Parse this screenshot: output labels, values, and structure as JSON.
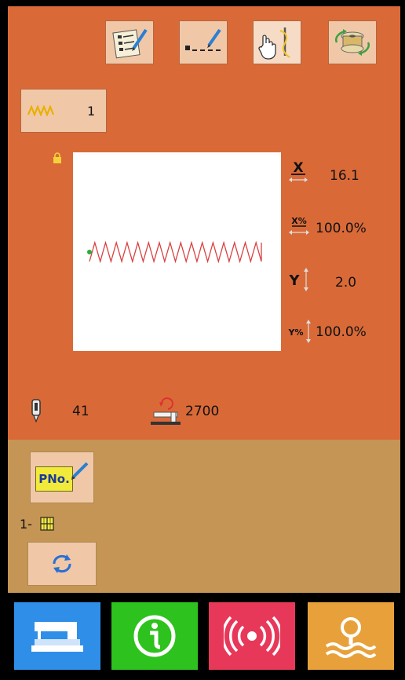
{
  "toolbar": {
    "items": [
      {
        "name": "checklist-edit-icon"
      },
      {
        "name": "dashed-line-edit-icon"
      },
      {
        "name": "hand-needle-icon"
      },
      {
        "name": "bobbin-wind-icon"
      }
    ]
  },
  "stitch": {
    "icon": "zigzag-icon",
    "value": "1"
  },
  "params": {
    "x": {
      "value": "16.1",
      "icon": "x-length-icon"
    },
    "x_scale": {
      "value": "100.0%",
      "icon": "x-scale-icon"
    },
    "y": {
      "value": "2.0",
      "icon": "y-length-icon"
    },
    "y_scale": {
      "value": "100.0%",
      "icon": "y-scale-icon"
    }
  },
  "status": {
    "needle": {
      "value": "41",
      "icon": "needle-icon"
    },
    "counter": {
      "value": "2700",
      "icon": "counter-icon"
    }
  },
  "pattern": {
    "pno_label": "PNo.",
    "selector_label": "1-"
  },
  "bottom_nav": [
    {
      "name": "sewing-machine-icon",
      "color": "#2f8fe8"
    },
    {
      "name": "info-icon",
      "color": "#27c21a"
    },
    {
      "name": "communication-icon",
      "color": "#e8385a"
    },
    {
      "name": "search-icon",
      "color": "#e8a13a"
    }
  ],
  "colors": {
    "top_panel": "#d96a38",
    "mid_panel": "#c49554",
    "stitch_line": "#d94040"
  }
}
